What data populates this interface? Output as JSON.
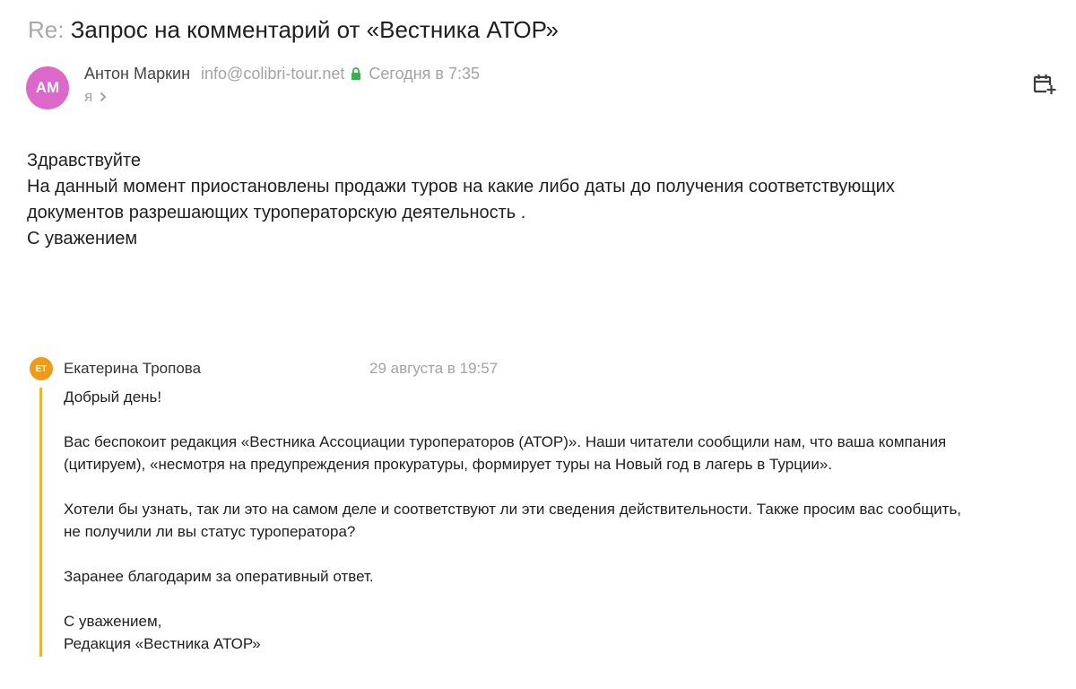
{
  "subject": {
    "prefix": "Re:",
    "text": "Запрос на комментарий от «Вестника АТОР»"
  },
  "sender": {
    "initials": "АМ",
    "name": "Антон Маркин",
    "email": "info@colibri-tour.net",
    "date": "Сегодня в 7:35",
    "to": "я",
    "avatar_color": "#dc68c9",
    "lock_color": "#33b54a"
  },
  "body": {
    "lines": [
      "Здравствуйте",
      "На данный момент приостановлены продажи туров на какие либо даты до получения соответствующих",
      "документов разрешающих туроператорскую деятельность .",
      "С уважением"
    ]
  },
  "quote": {
    "initials": "ЕТ",
    "name": "Екатерина Тропова",
    "date": "29 августа в 19:57",
    "avatar_color": "#ee9a1a",
    "bar_color": "#e8b637",
    "greeting": "Добрый день!",
    "p1": [
      "Вас беспокоит редакция «Вестника Ассоциации туроператоров (АТОР)». Наши читатели сообщили нам, что ваша компания",
      "(цитируем), «несмотря на предупреждения прокуратуры, формирует туры на Новый год в лагерь в Турции»."
    ],
    "p2": [
      "Хотели бы узнать, так ли это на самом деле и соответствуют ли эти сведения действительности. Также просим вас сообщить,",
      "не получили ли вы статус туроператора?"
    ],
    "p3": "Заранее благодарим за оперативный ответ.",
    "sign": [
      "С уважением,",
      "Редакция «Вестника АТОР»"
    ]
  }
}
